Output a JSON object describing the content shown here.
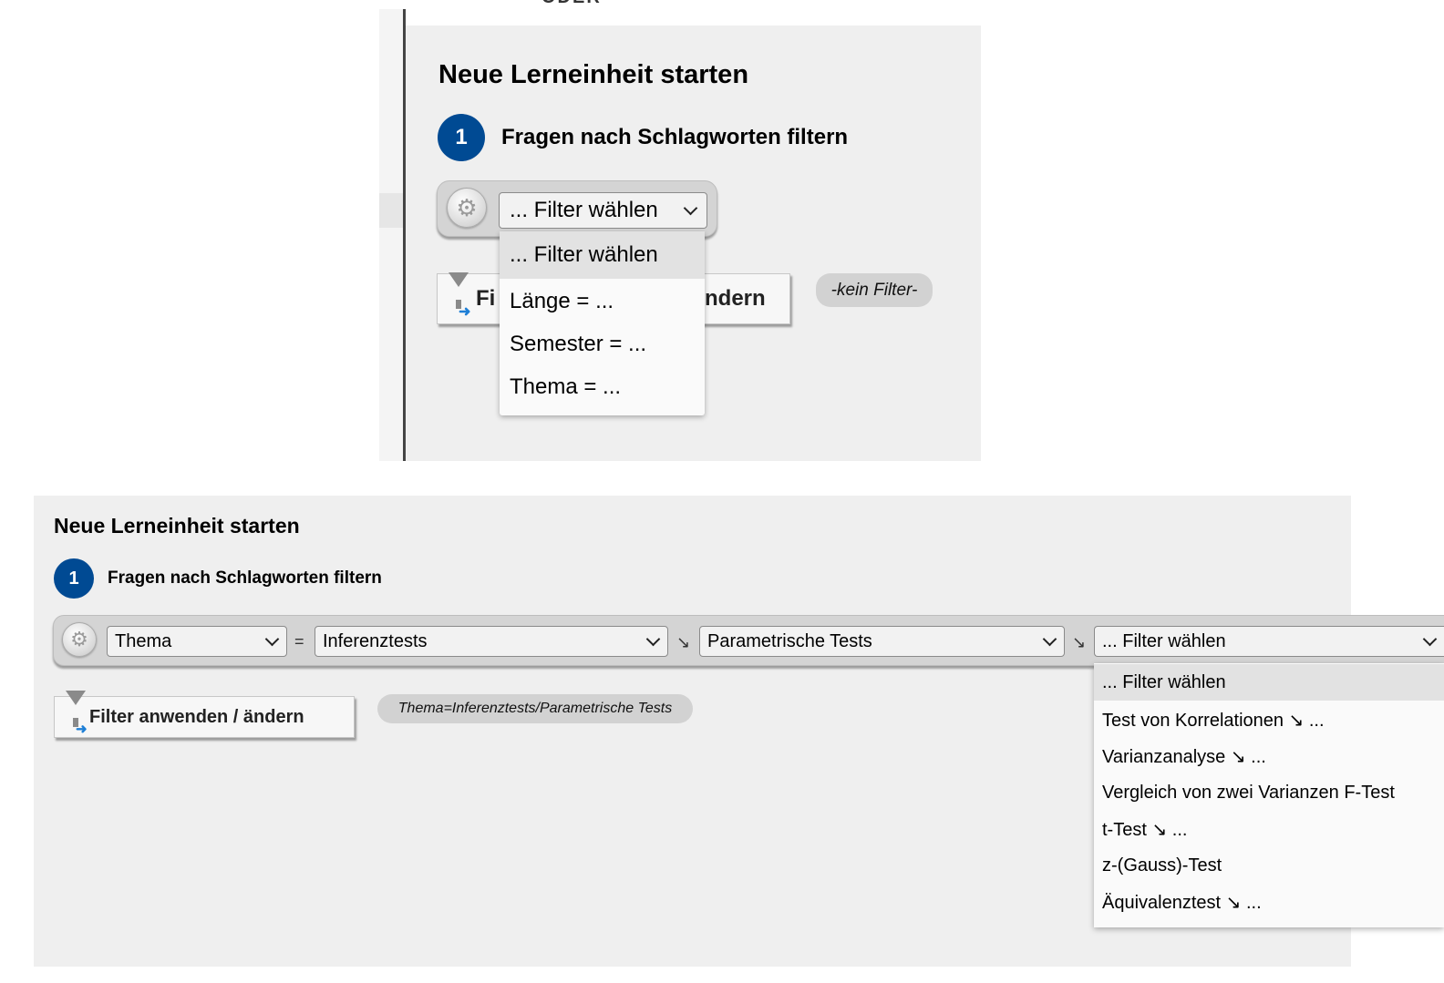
{
  "top": {
    "cut_text": "ODER",
    "heading": "Neue Lerneinheit starten",
    "step_number": "1",
    "step_label": "Fragen nach Schlagworten filtern",
    "select_value": "... Filter wählen",
    "apply_button_visible_left": "Fi",
    "apply_button_visible_right": "ndern",
    "filter_status": "-kein Filter-",
    "dropdown_options": [
      "... Filter wählen",
      "Länge = ...",
      "Semester = ...",
      "Thema = ..."
    ],
    "dropdown_selected_index": 0
  },
  "bottom": {
    "heading": "Neue Lerneinheit starten",
    "step_number": "1",
    "step_label": "Fragen nach Schlagworten filtern",
    "select_1": "Thema",
    "equals": "=",
    "select_2": "Inferenztests",
    "sep_2": "↘",
    "select_3": "Parametrische Tests",
    "sep_3": "↘",
    "select_4": "... Filter wählen",
    "apply_button": "Filter anwenden / ändern",
    "filter_status": "Thema=Inferenztests/Parametrische Tests",
    "dropdown_options": [
      "... Filter wählen",
      "Test von Korrelationen ↘ ...",
      "Varianzanalyse ↘ ...",
      "Vergleich von zwei Varianzen F-Test",
      "t-Test ↘ ...",
      "z-(Gauss)-Test",
      "Äquivalenztest ↘ ..."
    ],
    "dropdown_selected_index": 0
  },
  "colors": {
    "accent_step": "#004a93",
    "panel_bg": "#efefef",
    "bar_bg": "#d4d4d4"
  },
  "icons": [
    "gear-icon",
    "chevron-down-icon",
    "funnel-icon"
  ]
}
